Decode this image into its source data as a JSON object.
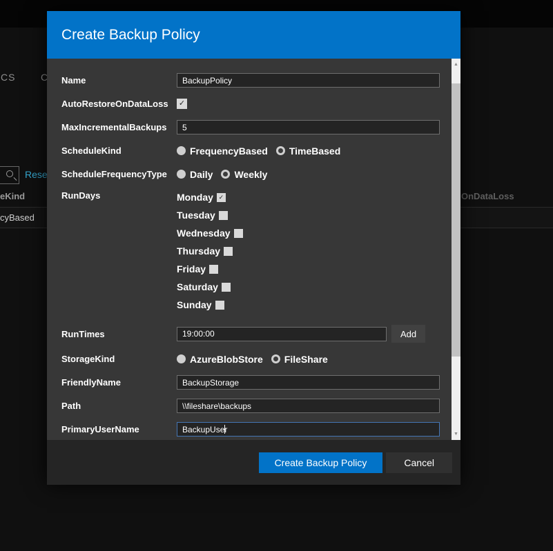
{
  "colors": {
    "accent": "#0273c8",
    "link": "#35a7cf",
    "focus": "#4576b5"
  },
  "icons": {
    "scroll_up": "▲",
    "scroll_down": "▼",
    "check": "✓"
  },
  "background": {
    "tab_fragment_left": "CS",
    "tab_fragment_right": "C",
    "reset_label": "Reset",
    "column_fragment_left": "eKind",
    "cell_fragment_left": "cyBased",
    "column_fragment_right": "OnDataLoss"
  },
  "dialog": {
    "title": "Create Backup Policy",
    "fields": {
      "name": {
        "label": "Name",
        "value": "BackupPolicy"
      },
      "autoRestoreOnDataLoss": {
        "label": "AutoRestoreOnDataLoss",
        "checked": true
      },
      "maxIncrementalBackups": {
        "label": "MaxIncrementalBackups",
        "value": "5"
      },
      "scheduleKind": {
        "label": "ScheduleKind",
        "options": [
          {
            "label": "FrequencyBased",
            "selected": false
          },
          {
            "label": "TimeBased",
            "selected": true
          }
        ]
      },
      "scheduleFrequencyType": {
        "label": "ScheduleFrequencyType",
        "options": [
          {
            "label": "Daily",
            "selected": false
          },
          {
            "label": "Weekly",
            "selected": true
          }
        ]
      },
      "runDays": {
        "label": "RunDays",
        "days": [
          {
            "name": "Monday",
            "checked": true
          },
          {
            "name": "Tuesday",
            "checked": false
          },
          {
            "name": "Wednesday",
            "checked": false
          },
          {
            "name": "Thursday",
            "checked": false
          },
          {
            "name": "Friday",
            "checked": false
          },
          {
            "name": "Saturday",
            "checked": false
          },
          {
            "name": "Sunday",
            "checked": false
          }
        ]
      },
      "runTimes": {
        "label": "RunTimes",
        "value": "19:00:00",
        "add_label": "Add"
      },
      "storageKind": {
        "label": "StorageKind",
        "options": [
          {
            "label": "AzureBlobStore",
            "selected": false
          },
          {
            "label": "FileShare",
            "selected": true
          }
        ]
      },
      "friendlyName": {
        "label": "FriendlyName",
        "value": "BackupStorage"
      },
      "path": {
        "label": "Path",
        "value": "\\\\fileshare\\backups"
      },
      "primaryUserName": {
        "label": "PrimaryUserName",
        "value": "BackupUser",
        "focused": true
      }
    },
    "footer": {
      "create_label": "Create Backup Policy",
      "cancel_label": "Cancel"
    }
  }
}
